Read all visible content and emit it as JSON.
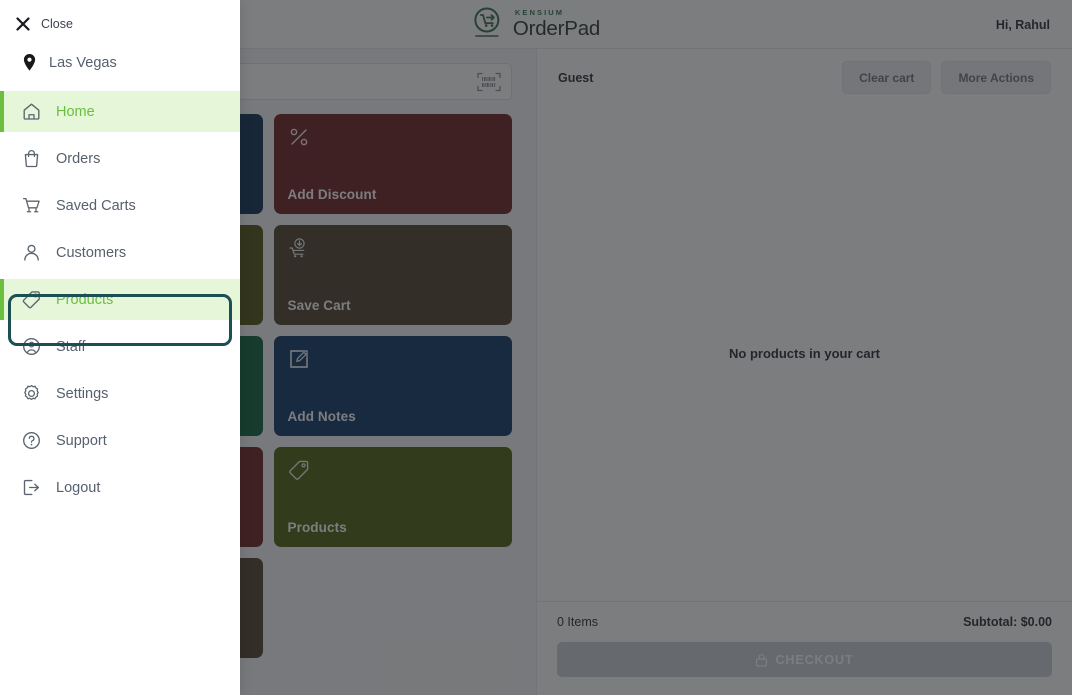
{
  "header": {
    "logo_kensium": "KENSIUM",
    "logo_orderpad": "OrderPad",
    "logo_icon": "shopping-cart-circle-icon",
    "greeting": "Hi, Rahul"
  },
  "search": {
    "value": "",
    "placeholder": "",
    "scan_icon": "barcode-scanner-icon"
  },
  "tiles": [
    {
      "label": "",
      "icon": "",
      "color": "#03294f"
    },
    {
      "label": "Add Discount",
      "icon": "percent-icon",
      "color": "#6a1b1b"
    },
    {
      "label": "",
      "icon": "",
      "color": "#4a4d0b"
    },
    {
      "label": "Save Cart",
      "icon": "save-cart-icon",
      "color": "#493venue"
    },
    {
      "label": "",
      "icon": "",
      "color": "#035c36"
    },
    {
      "label": "Add Notes",
      "icon": "edit-note-icon",
      "color": "#03305f"
    },
    {
      "label": "",
      "icon": "",
      "color": "#6a1b1b"
    },
    {
      "label": "Products",
      "icon": "tag-icon",
      "color": "#4a5a0b"
    },
    {
      "label": "",
      "icon": "",
      "color": "#493venue"
    }
  ],
  "tile_colors": {
    "navy": "#03294f",
    "dark_red": "#6a1b1b",
    "olive_dark": "#4a4d0b",
    "brown": "#4a3venue",
    "green": "#035c36",
    "blue": "#03305f",
    "olive": "#4a5a0b"
  },
  "cart": {
    "customer": "Guest",
    "clear_cart_label": "Clear cart",
    "more_actions_label": "More Actions",
    "empty_message": "No products in your cart",
    "items_count": "0 Items",
    "subtotal": "Subtotal: $0.00",
    "checkout_label": "CHECKOUT",
    "checkout_icon": "lock-icon"
  },
  "drawer": {
    "close_label": "Close",
    "close_icon": "close-x-icon",
    "location": "Las Vegas",
    "location_icon": "location-pin-icon",
    "items": [
      {
        "label": "Home",
        "icon": "home-icon",
        "active": true,
        "focused": false
      },
      {
        "label": "Orders",
        "icon": "bag-icon",
        "active": false,
        "focused": false
      },
      {
        "label": "Saved Carts",
        "icon": "cart-icon",
        "active": false,
        "focused": false
      },
      {
        "label": "Customers",
        "icon": "user-icon",
        "active": false,
        "focused": false
      },
      {
        "label": "Products",
        "icon": "tag-icon",
        "active": true,
        "focused": true
      },
      {
        "label": "Staff",
        "icon": "user-circle-icon",
        "active": false,
        "focused": false
      },
      {
        "label": "Settings",
        "icon": "gear-icon",
        "active": false,
        "focused": false
      },
      {
        "label": "Support",
        "icon": "question-icon",
        "active": false,
        "focused": false
      },
      {
        "label": "Logout",
        "icon": "logout-icon",
        "active": false,
        "focused": false
      }
    ]
  },
  "colors": {
    "accent_green": "#6bbf3f",
    "active_bg": "#e5f6d9",
    "focus_ring": "#1b4f53",
    "overlay": "rgba(36,38,41,0.60)"
  }
}
